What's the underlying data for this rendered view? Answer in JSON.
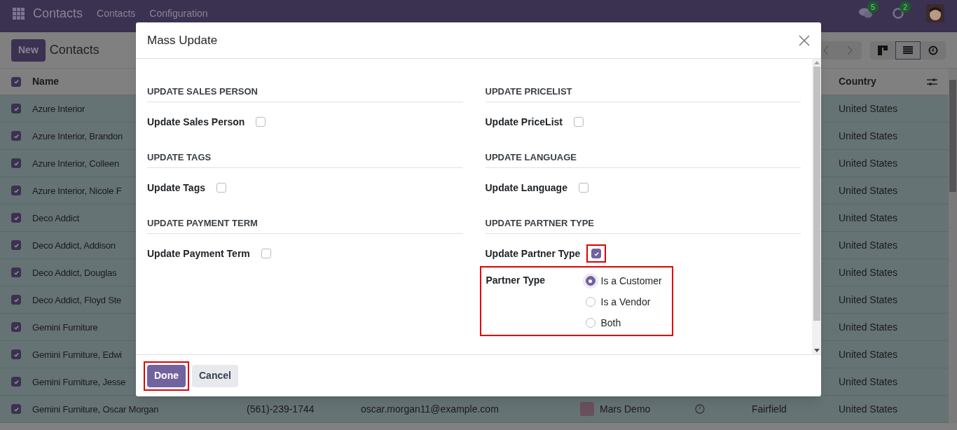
{
  "navbar": {
    "app_title": "Contacts",
    "menu": [
      "Contacts",
      "Configuration"
    ],
    "messages_count": "5",
    "activities_count": "2"
  },
  "control_panel": {
    "new_button": "New",
    "breadcrumb": "Contacts",
    "views": [
      {
        "kind": "kanban",
        "selected": false
      },
      {
        "kind": "list",
        "selected": true
      },
      {
        "kind": "activity",
        "selected": false
      }
    ]
  },
  "list": {
    "header_checked": true,
    "columns": [
      "Name",
      "Country"
    ],
    "rows": [
      {
        "selected": true,
        "name": "Azure Interior",
        "country": "United States"
      },
      {
        "selected": true,
        "name": "Azure Interior, Brandon",
        "country": "United States"
      },
      {
        "selected": true,
        "name": "Azure Interior, Colleen",
        "country": "United States"
      },
      {
        "selected": true,
        "name": "Azure Interior, Nicole F",
        "country": "United States"
      },
      {
        "selected": true,
        "name": "Deco Addict",
        "country": "United States"
      },
      {
        "selected": true,
        "name": "Deco Addict, Addison",
        "country": "United States"
      },
      {
        "selected": true,
        "name": "Deco Addict, Douglas",
        "country": "United States"
      },
      {
        "selected": true,
        "name": "Deco Addict, Floyd Ste",
        "country": "United States"
      },
      {
        "selected": true,
        "name": "Gemini Furniture",
        "country": "United States"
      },
      {
        "selected": true,
        "name": "Gemini Furniture, Edwi",
        "country": "United States"
      },
      {
        "selected": true,
        "name": "Gemini Furniture, Jesse",
        "country": "United States"
      },
      {
        "selected": true,
        "name": "Gemini Furniture, Oscar Morgan",
        "phone": "(561)-239-1744",
        "email": "oscar.morgan11@example.com",
        "salesperson": "Mars Demo",
        "city": "Fairfield",
        "country": "United States"
      }
    ]
  },
  "dialog": {
    "title": "Mass Update",
    "left_column": [
      {
        "heading": "UPDATE SALES PERSON",
        "field": {
          "label": "Update Sales Person",
          "checked": false
        }
      },
      {
        "heading": "UPDATE TAGS",
        "field": {
          "label": "Update Tags",
          "checked": false
        }
      },
      {
        "heading": "UPDATE PAYMENT TERM",
        "field": {
          "label": "Update Payment Term",
          "checked": false
        }
      }
    ],
    "right_column": [
      {
        "heading": "UPDATE PRICELIST",
        "field": {
          "label": "Update PriceList",
          "checked": false
        }
      },
      {
        "heading": "UPDATE LANGUAGE",
        "field": {
          "label": "Update Language",
          "checked": false
        }
      },
      {
        "heading": "UPDATE PARTNER TYPE",
        "field": {
          "label": "Update Partner Type",
          "checked": true,
          "highlighted": true
        },
        "radio": {
          "label": "Partner Type",
          "highlighted": true,
          "options": [
            {
              "label": "Is a Customer",
              "selected": true
            },
            {
              "label": "Is a Vendor",
              "selected": false
            },
            {
              "label": "Both",
              "selected": false
            }
          ]
        }
      }
    ],
    "buttons": [
      {
        "label": "Done",
        "kind": "primary",
        "highlighted": true
      },
      {
        "label": "Cancel",
        "kind": "secondary",
        "highlighted": false
      }
    ]
  }
}
